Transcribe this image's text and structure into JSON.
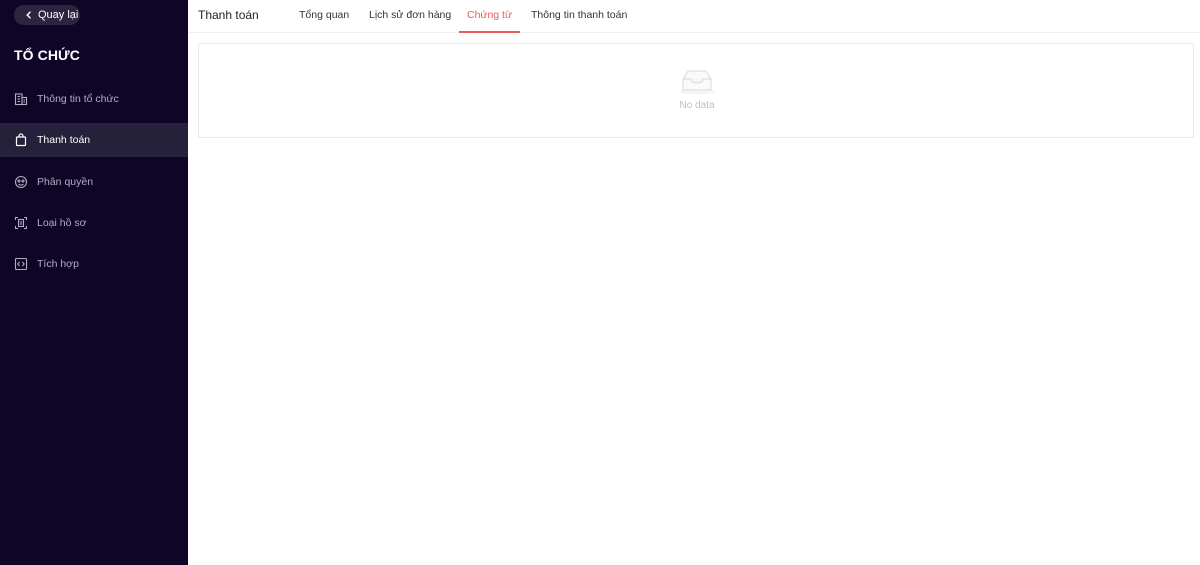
{
  "sidebar": {
    "back_label": "Quay lại",
    "section_title": "TỔ CHỨC",
    "items": [
      {
        "label": "Thông tin tổ chức",
        "icon": "building-icon"
      },
      {
        "label": "Thanh toán",
        "icon": "shopping-bag-icon"
      },
      {
        "label": "Phân quyền",
        "icon": "permission-icon"
      },
      {
        "label": "Loại hồ sơ",
        "icon": "document-scan-icon"
      },
      {
        "label": "Tích hợp",
        "icon": "code-integration-icon"
      }
    ],
    "active_item": "Thanh toán"
  },
  "header": {
    "title": "Thanh toán",
    "tabs": [
      {
        "label": "Tổng quan"
      },
      {
        "label": "Lịch sử đơn hàng"
      },
      {
        "label": "Chứng từ"
      },
      {
        "label": "Thông tin thanh toán"
      }
    ],
    "active_tab": "Chứng từ"
  },
  "content": {
    "empty_text": "No data",
    "empty_icon": "inbox-empty-icon"
  },
  "colors": {
    "sidebar_bg": "#0f0526",
    "active_nav_bg": "#26213a",
    "accent": "#e85b5b"
  }
}
